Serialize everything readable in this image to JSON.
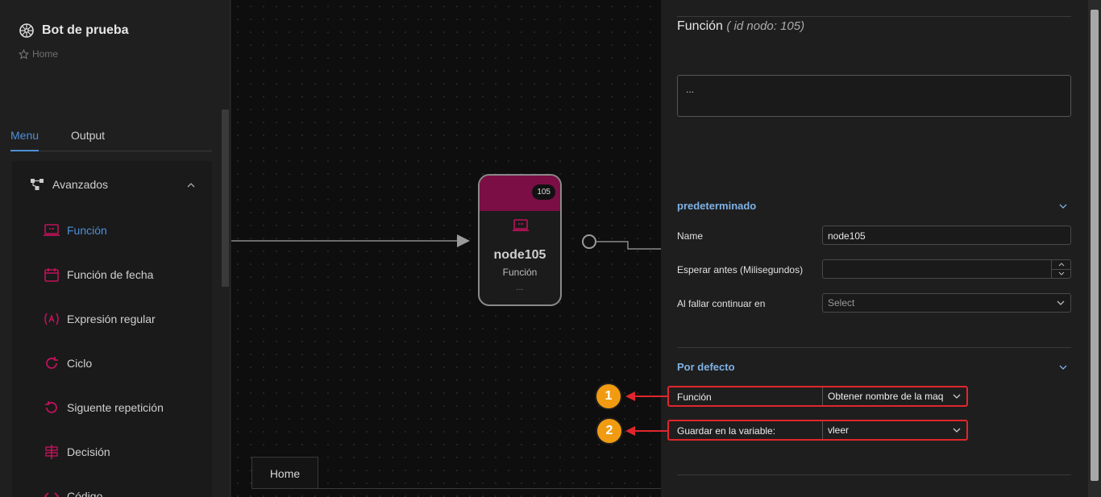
{
  "app": {
    "title": "Bot de prueba",
    "breadcrumb": "Home"
  },
  "tabs": [
    {
      "label": "Menu",
      "active": true
    },
    {
      "label": "Output",
      "active": false
    }
  ],
  "menu": {
    "group": "Avanzados",
    "items": [
      {
        "label": "Función",
        "icon": "laptop-icon",
        "active": true
      },
      {
        "label": "Función de fecha",
        "icon": "calendar-icon"
      },
      {
        "label": "Expresión regular",
        "icon": "regex-icon"
      },
      {
        "label": "Ciclo",
        "icon": "loop-icon"
      },
      {
        "label": "Siguente repetición",
        "icon": "repeat-icon"
      },
      {
        "label": "Decisión",
        "icon": "decision-icon"
      },
      {
        "label": "Código",
        "icon": "code-icon"
      }
    ]
  },
  "canvas": {
    "node": {
      "badge": "105",
      "title": "node105",
      "type": "Función",
      "dots": "..."
    },
    "tab": "Home"
  },
  "panel": {
    "title": "Función",
    "subtitle": "( id nodo: 105)",
    "textarea": "...",
    "section1": {
      "title": "predeterminado",
      "fields": {
        "name_label": "Name",
        "name_value": "node105",
        "wait_label": "Esperar antes (Milisegundos)",
        "wait_value": "",
        "fail_label": "Al fallar continuar en",
        "fail_placeholder": "Select"
      }
    },
    "section2": {
      "title": "Por defecto",
      "funcion_label": "Función",
      "funcion_value": "Obtener nombre de la maq",
      "var_label": "Guardar en la variable:",
      "var_value": "vleer"
    }
  },
  "callouts": [
    "1",
    "2"
  ],
  "colors": {
    "accent": "#4e8fd8",
    "node_header": "#7a0e45",
    "highlight": "#e0262c",
    "callout": "#f09b12",
    "menu_icon": "#c0125a"
  }
}
